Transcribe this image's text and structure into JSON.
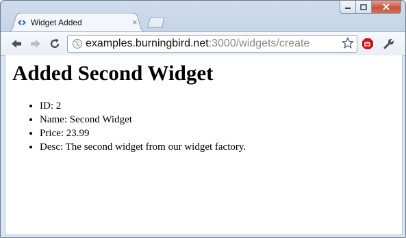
{
  "window": {
    "tab_title": "Widget Added",
    "tab_close_glyph": "×"
  },
  "toolbar": {
    "url_host": "examples.burningbird.net",
    "url_path": ":3000/widgets/create",
    "icons": [
      "back-icon",
      "forward-icon",
      "reload-icon",
      "bookmark-star-icon",
      "adblock-icon",
      "wrench-icon"
    ]
  },
  "page": {
    "heading": "Added Second Widget",
    "items": [
      "ID: 2",
      "Name: Second Widget",
      "Price: 23.99",
      "Desc: The second widget from our widget factory."
    ]
  }
}
